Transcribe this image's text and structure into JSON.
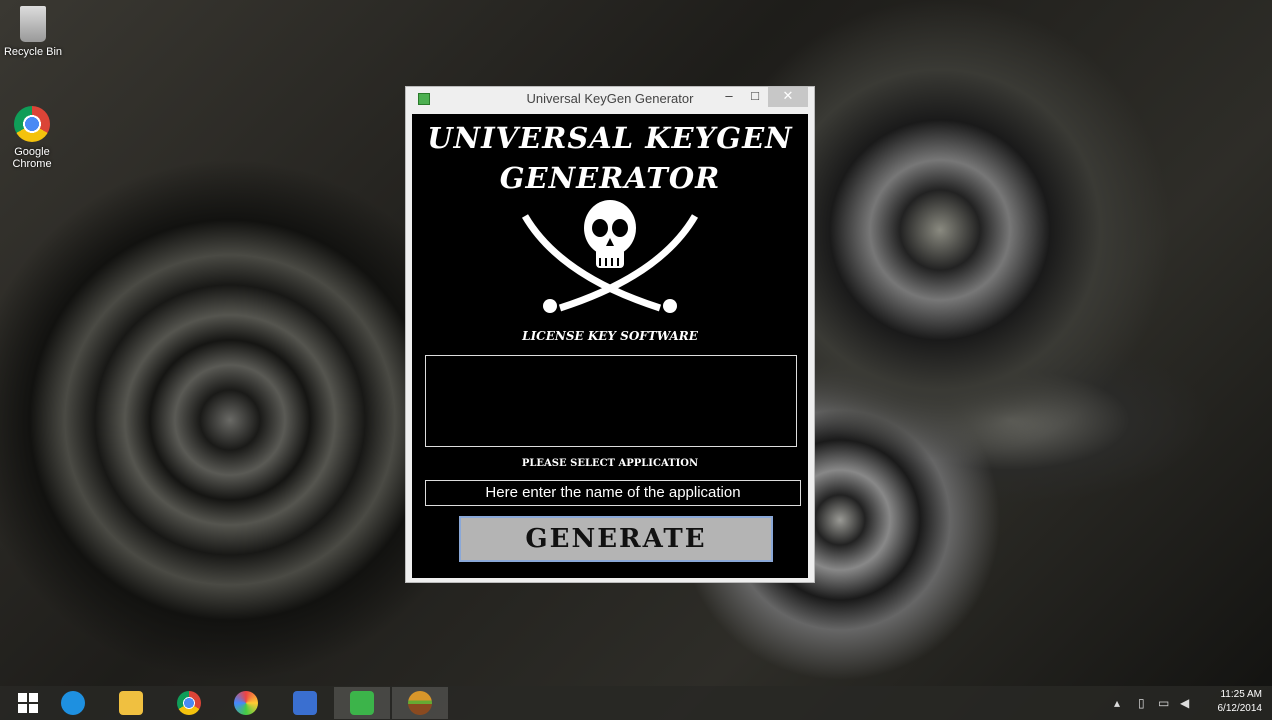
{
  "desktop": {
    "icons": [
      {
        "label": "Recycle Bin",
        "icon": "recycle-bin-icon"
      },
      {
        "label": "Google Chrome",
        "icon": "chrome-icon"
      }
    ]
  },
  "window": {
    "title": "Universal KeyGen Generator",
    "minimize": "–",
    "maximize": "□",
    "close": "✕",
    "heading_line1": "UNIVERSAL KEYGEN",
    "heading_line2": "GENERATOR",
    "logo": "skull-crossed-swords",
    "subtitle": "LICENSE KEY SOFTWARE",
    "output_value": "",
    "select_label": "PLEASE SELECT APPLICATION",
    "input_value": "Here enter the name of the application",
    "generate_label": "GENERATE"
  },
  "taskbar": {
    "apps": [
      "start",
      "internet-explorer",
      "file-explorer",
      "chrome",
      "paint",
      "network",
      "keygen",
      "app"
    ],
    "time": "11:25 AM",
    "date": "6/12/2014"
  }
}
